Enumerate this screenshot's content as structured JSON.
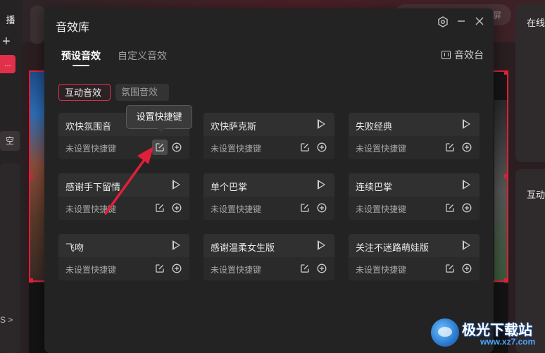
{
  "background": {
    "left_rail": {
      "top_label": "播",
      "red_item_label": "...",
      "box_label": "空",
      "chevron_label": "S >"
    },
    "search_hint": "屏",
    "right_labels": [
      "在线",
      "互动"
    ]
  },
  "dialog": {
    "title": "音效库",
    "tabs": [
      {
        "label": "预设音效",
        "active": true
      },
      {
        "label": "自定义音效",
        "active": false
      }
    ],
    "console_label": "音效台",
    "sub_tabs": [
      {
        "label": "互动音效",
        "active": true
      },
      {
        "label": "氛围音效",
        "active": false
      }
    ],
    "tooltip": "设置快捷键",
    "cards": [
      {
        "name": "欢快氛围音",
        "shortcut": "未设置快捷键"
      },
      {
        "name": "欢快萨克斯",
        "shortcut": "未设置快捷键"
      },
      {
        "name": "失败经典",
        "shortcut": "未设置快捷键"
      },
      {
        "name": "感谢手下留情",
        "shortcut": "未设置快捷键"
      },
      {
        "name": "单个巴掌",
        "shortcut": "未设置快捷键"
      },
      {
        "name": "连续巴掌",
        "shortcut": "未设置快捷键"
      },
      {
        "name": "飞吻",
        "shortcut": "未设置快捷键"
      },
      {
        "name": "感谢温柔女生版",
        "shortcut": "未设置快捷键"
      },
      {
        "name": "关注不迷路萌娃版",
        "shortcut": "未设置快捷键"
      }
    ]
  },
  "watermark": {
    "text": "极光下载站",
    "url": "www.xz7.com"
  },
  "colors": {
    "accent": "#e0304a",
    "dialog_bg": "#232323",
    "arrow": "#e0203a"
  }
}
